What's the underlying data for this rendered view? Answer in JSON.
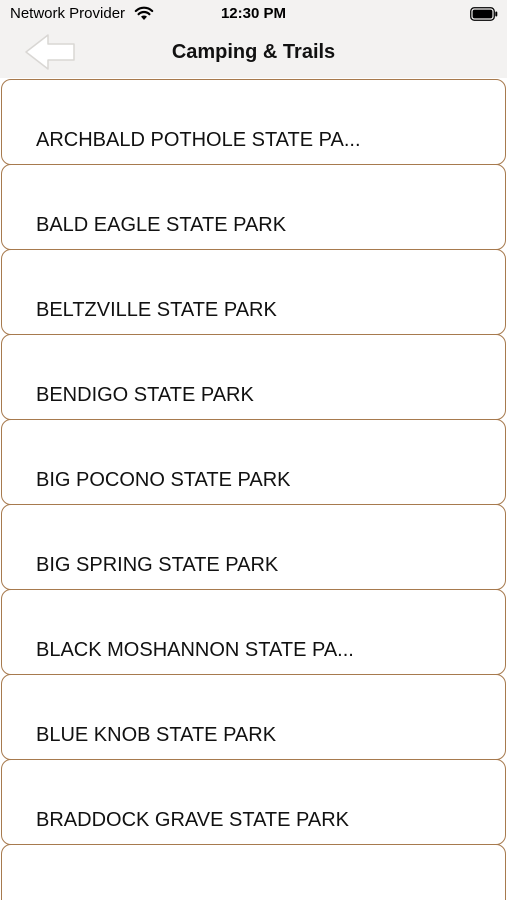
{
  "status_bar": {
    "carrier": "Network Provider",
    "time": "12:30 PM"
  },
  "nav": {
    "back_icon": "back-arrow-icon",
    "title": "Camping & Trails"
  },
  "colors": {
    "bar_background": "#f3f2f1",
    "item_border": "#a77a4e",
    "text": "#111111"
  },
  "parks": [
    {
      "label": "ARCHBALD POTHOLE STATE PA..."
    },
    {
      "label": "BALD EAGLE STATE PARK"
    },
    {
      "label": "BELTZVILLE STATE PARK"
    },
    {
      "label": "BENDIGO STATE PARK"
    },
    {
      "label": "BIG POCONO STATE PARK"
    },
    {
      "label": "BIG SPRING STATE PARK"
    },
    {
      "label": "BLACK MOSHANNON STATE PA..."
    },
    {
      "label": "BLUE KNOB STATE PARK"
    },
    {
      "label": "BRADDOCK GRAVE STATE PARK"
    },
    {
      "label": ""
    }
  ]
}
